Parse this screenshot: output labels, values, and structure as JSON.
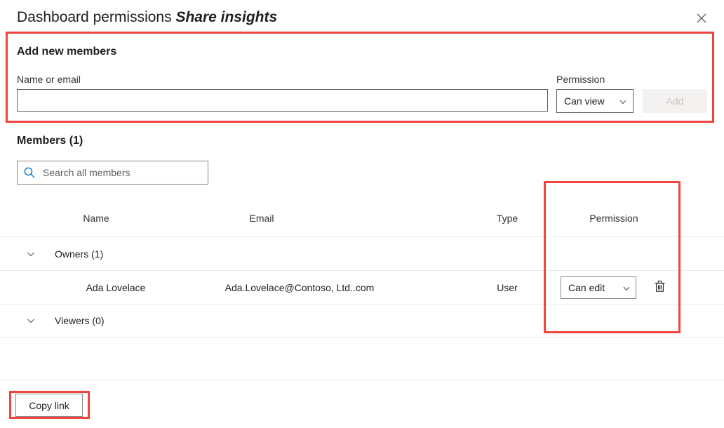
{
  "dialog": {
    "title_main": "Dashboard permissions ",
    "title_app": "Share insights",
    "close_icon": "close-icon"
  },
  "add_members": {
    "heading": "Add new members",
    "name_label": "Name or email",
    "name_value": "",
    "name_placeholder": "",
    "permission_label": "Permission",
    "permission_value": "Can view",
    "permission_options": [
      "Can view",
      "Can edit"
    ],
    "add_button": "Add",
    "add_button_enabled": false,
    "chevron_icon": "chevron-down-icon"
  },
  "members": {
    "heading": "Members (1)",
    "search_value": "",
    "search_placeholder": "Search all members",
    "search_icon": "search-icon",
    "columns": {
      "name": "Name",
      "email": "Email",
      "type": "Type",
      "permission": "Permission"
    },
    "groups": [
      {
        "label": "Owners (1)",
        "expanded": true,
        "chevron_icon": "chevron-down-icon",
        "rows": [
          {
            "name": "Ada Lovelace",
            "email": "Ada.Lovelace@Contoso, Ltd..com",
            "type": "User",
            "permission": "Can edit",
            "permission_options": [
              "Can view",
              "Can edit"
            ],
            "delete_icon": "trash-icon"
          }
        ]
      },
      {
        "label": "Viewers (0)",
        "expanded": true,
        "chevron_icon": "chevron-down-icon",
        "rows": []
      }
    ]
  },
  "footer": {
    "copy_link_button": "Copy link"
  },
  "annotations": {
    "color": "#f0443e",
    "regions": [
      "add-new-members",
      "permission-column",
      "copy-link"
    ]
  }
}
